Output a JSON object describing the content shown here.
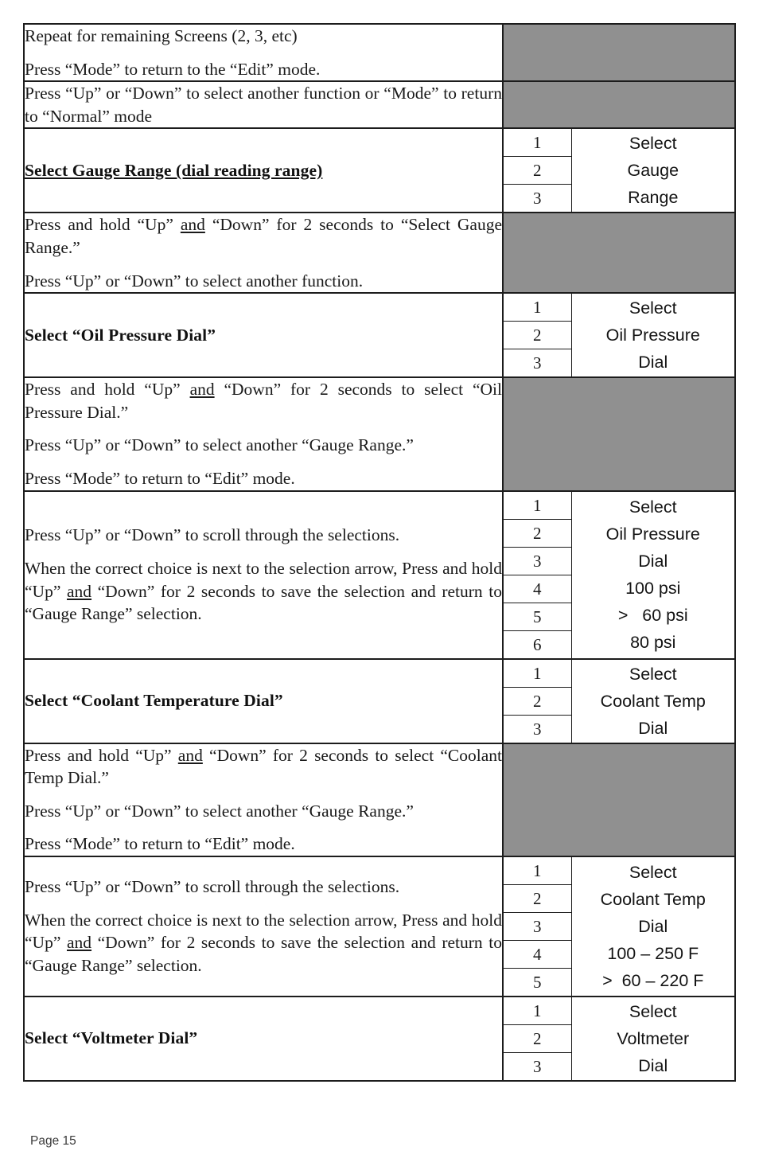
{
  "document": {
    "footer_label": "Page 15"
  },
  "colors": {
    "gray_screen": "#909090",
    "border": "#1c1c1c",
    "text": "#1a1a1a"
  },
  "table": {
    "sections": [
      {
        "id": "repeat-screens",
        "kind": "instruction",
        "left_paragraphs": [
          "Repeat for remaining Screens (2, 3, etc)",
          "Press “Mode” to return to the “Edit” mode."
        ],
        "right_kind": "gray"
      },
      {
        "id": "select-another-function",
        "kind": "instruction",
        "left_paragraphs": [
          "Press “Up” or “Down” to select another function or “Mode” to return to “Normal” mode"
        ],
        "right_kind": "gray"
      },
      {
        "id": "select-gauge-range",
        "kind": "heading",
        "heading_main": "Select Gauge Range  (dial reading range)",
        "right_kind": "screen",
        "rows": [
          "1",
          "2",
          "3"
        ],
        "display_lines": [
          "Select",
          "Gauge",
          "Range"
        ]
      },
      {
        "id": "gauge-range-instructions",
        "kind": "instruction",
        "left_paragraphs": [
          "Press and hold “Up” and “Down” for 2 seconds to “Select Gauge Range.”",
          "Press “Up” or “Down” to select another function."
        ],
        "right_kind": "gray"
      },
      {
        "id": "select-oil-pressure-dial",
        "kind": "heading",
        "heading_main": "Select “Oil Pressure Dial”",
        "right_kind": "screen",
        "rows": [
          "1",
          "2",
          "3"
        ],
        "display_lines": [
          "Select",
          "Oil Pressure",
          "Dial"
        ]
      },
      {
        "id": "oil-pressure-dial-instructions",
        "kind": "instruction",
        "left_paragraphs": [
          "Press and hold “Up” and “Down” for 2 seconds to select “Oil Pressure Dial.”",
          "Press “Up” or “Down” to select another “Gauge Range.”",
          "Press “Mode” to return to “Edit” mode."
        ],
        "right_kind": "gray"
      },
      {
        "id": "oil-pressure-scroll",
        "kind": "instruction",
        "left_paragraphs": [
          "Press “Up” or “Down” to scroll through the selections.",
          "When the correct choice is next to the selection arrow, Press and hold “Up” and “Down” for 2 seconds to save the selection and return to “Gauge Range” selection."
        ],
        "right_kind": "screen",
        "rows": [
          "1",
          "2",
          "3",
          "4",
          "5",
          "6"
        ],
        "display_lines": [
          "Select",
          "Oil Pressure",
          "Dial",
          "100 psi",
          ">   60 psi",
          "80 psi"
        ]
      },
      {
        "id": "select-coolant-temperature-dial",
        "kind": "heading",
        "heading_main": "Select “Coolant Temperature Dial”",
        "right_kind": "screen",
        "rows": [
          "1",
          "2",
          "3"
        ],
        "display_lines": [
          "Select",
          "Coolant Temp",
          "Dial"
        ]
      },
      {
        "id": "coolant-temp-dial-instructions",
        "kind": "instruction",
        "left_paragraphs": [
          "Press and hold “Up” and “Down” for 2 seconds to select “Coolant Temp Dial.”",
          "Press “Up” or “Down” to select another “Gauge Range.”",
          "Press “Mode” to return to “Edit” mode."
        ],
        "right_kind": "gray"
      },
      {
        "id": "coolant-temp-scroll",
        "kind": "instruction",
        "left_paragraphs": [
          "Press “Up” or “Down” to scroll through the selections.",
          "When the correct choice is next to the selection arrow, Press and hold “Up” and “Down” for 2 seconds to save the selection and return to “Gauge Range” selection."
        ],
        "right_kind": "screen",
        "rows": [
          "1",
          "2",
          "3",
          "4",
          "5"
        ],
        "display_lines": [
          "Select",
          "Coolant Temp",
          "Dial",
          "100 – 250 F",
          ">  60 – 220 F"
        ]
      },
      {
        "id": "select-voltmeter-dial",
        "kind": "heading",
        "heading_main": "Select “Voltmeter Dial”",
        "right_kind": "screen",
        "rows": [
          "1",
          "2",
          "3"
        ],
        "display_lines": [
          "Select",
          "Voltmeter",
          "Dial"
        ]
      }
    ]
  }
}
